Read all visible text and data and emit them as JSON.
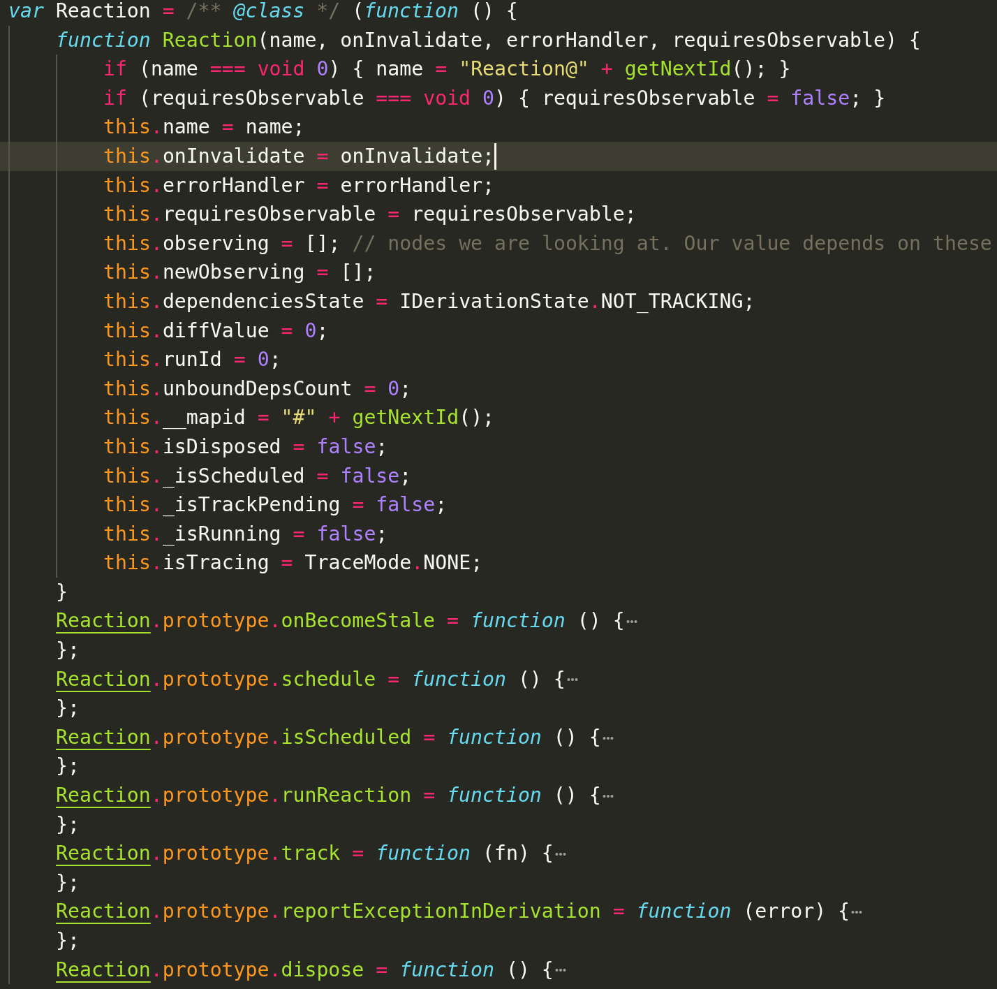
{
  "lines": [
    {
      "current": false,
      "folded": false,
      "tokens": [
        {
          "kind": "storage",
          "text": "var"
        },
        {
          "kind": "plain",
          "text": " Reaction"
        },
        {
          "kind": "keyword",
          "text": " = "
        },
        {
          "kind": "comment",
          "text": "/** "
        },
        {
          "kind": "doc-tag",
          "text": "@class"
        },
        {
          "kind": "comment",
          "text": " */"
        },
        {
          "kind": "plain",
          "text": " ("
        },
        {
          "kind": "storage",
          "text": "function"
        },
        {
          "kind": "plain",
          "text": " () {"
        }
      ],
      "children": [
        {
          "current": false,
          "folded": false,
          "tokens": [
            {
              "kind": "storage",
              "text": "function "
            },
            {
              "kind": "entity",
              "text": "Reaction"
            },
            {
              "kind": "plain",
              "text": "(name, onInvalidate, errorHandler, requiresObservable) {"
            }
          ],
          "children": [
            {
              "current": false,
              "folded": false,
              "tokens": [
                {
                  "kind": "keyword",
                  "text": "if"
                },
                {
                  "kind": "plain",
                  "text": " (name"
                },
                {
                  "kind": "keyword",
                  "text": " === void "
                },
                {
                  "kind": "number",
                  "text": "0"
                },
                {
                  "kind": "plain",
                  "text": ") { name"
                },
                {
                  "kind": "keyword",
                  "text": " = "
                },
                {
                  "kind": "string",
                  "text": "\"Reaction@\""
                },
                {
                  "kind": "keyword",
                  "text": " + "
                },
                {
                  "kind": "entity",
                  "text": "getNextId"
                },
                {
                  "kind": "plain",
                  "text": "(); }"
                }
              ]
            },
            {
              "current": false,
              "folded": false,
              "tokens": [
                {
                  "kind": "keyword",
                  "text": "if"
                },
                {
                  "kind": "plain",
                  "text": " (requiresObservable"
                },
                {
                  "kind": "keyword",
                  "text": " === void "
                },
                {
                  "kind": "number",
                  "text": "0"
                },
                {
                  "kind": "plain",
                  "text": ") { requiresObservable"
                },
                {
                  "kind": "keyword",
                  "text": " = "
                },
                {
                  "kind": "number",
                  "text": "false"
                },
                {
                  "kind": "plain",
                  "text": "; }"
                }
              ]
            },
            {
              "current": false,
              "folded": false,
              "tokens": [
                {
                  "kind": "this",
                  "text": "this"
                },
                {
                  "kind": "keyword",
                  "text": "."
                },
                {
                  "kind": "plain",
                  "text": "name"
                },
                {
                  "kind": "keyword",
                  "text": " = "
                },
                {
                  "kind": "plain",
                  "text": "name;"
                }
              ]
            },
            {
              "current": true,
              "folded": false,
              "tokens": [
                {
                  "kind": "this",
                  "text": "this"
                },
                {
                  "kind": "keyword",
                  "text": "."
                },
                {
                  "kind": "plain",
                  "text": "onInvalidate"
                },
                {
                  "kind": "keyword",
                  "text": " = "
                },
                {
                  "kind": "plain",
                  "text": "onInvalidate;"
                }
              ]
            },
            {
              "current": false,
              "folded": false,
              "tokens": [
                {
                  "kind": "this",
                  "text": "this"
                },
                {
                  "kind": "keyword",
                  "text": "."
                },
                {
                  "kind": "plain",
                  "text": "errorHandler"
                },
                {
                  "kind": "keyword",
                  "text": " = "
                },
                {
                  "kind": "plain",
                  "text": "errorHandler;"
                }
              ]
            },
            {
              "current": false,
              "folded": false,
              "tokens": [
                {
                  "kind": "this",
                  "text": "this"
                },
                {
                  "kind": "keyword",
                  "text": "."
                },
                {
                  "kind": "plain",
                  "text": "requiresObservable"
                },
                {
                  "kind": "keyword",
                  "text": " = "
                },
                {
                  "kind": "plain",
                  "text": "requiresObservable;"
                }
              ]
            },
            {
              "current": false,
              "folded": false,
              "tokens": [
                {
                  "kind": "this",
                  "text": "this"
                },
                {
                  "kind": "keyword",
                  "text": "."
                },
                {
                  "kind": "plain",
                  "text": "observing"
                },
                {
                  "kind": "keyword",
                  "text": " = "
                },
                {
                  "kind": "plain",
                  "text": "[]; "
                },
                {
                  "kind": "comment",
                  "text": "// nodes we are looking at. Our value depends on these"
                }
              ]
            },
            {
              "current": false,
              "folded": false,
              "tokens": [
                {
                  "kind": "this",
                  "text": "this"
                },
                {
                  "kind": "keyword",
                  "text": "."
                },
                {
                  "kind": "plain",
                  "text": "newObserving"
                },
                {
                  "kind": "keyword",
                  "text": " = "
                },
                {
                  "kind": "plain",
                  "text": "[];"
                }
              ]
            },
            {
              "current": false,
              "folded": false,
              "tokens": [
                {
                  "kind": "this",
                  "text": "this"
                },
                {
                  "kind": "keyword",
                  "text": "."
                },
                {
                  "kind": "plain",
                  "text": "dependenciesState"
                },
                {
                  "kind": "keyword",
                  "text": " = "
                },
                {
                  "kind": "plain",
                  "text": "IDerivationState"
                },
                {
                  "kind": "keyword",
                  "text": "."
                },
                {
                  "kind": "plain",
                  "text": "NOT_TRACKING;"
                }
              ]
            },
            {
              "current": false,
              "folded": false,
              "tokens": [
                {
                  "kind": "this",
                  "text": "this"
                },
                {
                  "kind": "keyword",
                  "text": "."
                },
                {
                  "kind": "plain",
                  "text": "diffValue"
                },
                {
                  "kind": "keyword",
                  "text": " = "
                },
                {
                  "kind": "number",
                  "text": "0"
                },
                {
                  "kind": "plain",
                  "text": ";"
                }
              ]
            },
            {
              "current": false,
              "folded": false,
              "tokens": [
                {
                  "kind": "this",
                  "text": "this"
                },
                {
                  "kind": "keyword",
                  "text": "."
                },
                {
                  "kind": "plain",
                  "text": "runId"
                },
                {
                  "kind": "keyword",
                  "text": " = "
                },
                {
                  "kind": "number",
                  "text": "0"
                },
                {
                  "kind": "plain",
                  "text": ";"
                }
              ]
            },
            {
              "current": false,
              "folded": false,
              "tokens": [
                {
                  "kind": "this",
                  "text": "this"
                },
                {
                  "kind": "keyword",
                  "text": "."
                },
                {
                  "kind": "plain",
                  "text": "unboundDepsCount"
                },
                {
                  "kind": "keyword",
                  "text": " = "
                },
                {
                  "kind": "number",
                  "text": "0"
                },
                {
                  "kind": "plain",
                  "text": ";"
                }
              ]
            },
            {
              "current": false,
              "folded": false,
              "tokens": [
                {
                  "kind": "this",
                  "text": "this"
                },
                {
                  "kind": "keyword",
                  "text": "."
                },
                {
                  "kind": "plain",
                  "text": "__mapid"
                },
                {
                  "kind": "keyword",
                  "text": " = "
                },
                {
                  "kind": "string",
                  "text": "\"#\""
                },
                {
                  "kind": "keyword",
                  "text": " + "
                },
                {
                  "kind": "entity",
                  "text": "getNextId"
                },
                {
                  "kind": "plain",
                  "text": "();"
                }
              ]
            },
            {
              "current": false,
              "folded": false,
              "tokens": [
                {
                  "kind": "this",
                  "text": "this"
                },
                {
                  "kind": "keyword",
                  "text": "."
                },
                {
                  "kind": "plain",
                  "text": "isDisposed"
                },
                {
                  "kind": "keyword",
                  "text": " = "
                },
                {
                  "kind": "number",
                  "text": "false"
                },
                {
                  "kind": "plain",
                  "text": ";"
                }
              ]
            },
            {
              "current": false,
              "folded": false,
              "tokens": [
                {
                  "kind": "this",
                  "text": "this"
                },
                {
                  "kind": "keyword",
                  "text": "."
                },
                {
                  "kind": "plain",
                  "text": "_isScheduled"
                },
                {
                  "kind": "keyword",
                  "text": " = "
                },
                {
                  "kind": "number",
                  "text": "false"
                },
                {
                  "kind": "plain",
                  "text": ";"
                }
              ]
            },
            {
              "current": false,
              "folded": false,
              "tokens": [
                {
                  "kind": "this",
                  "text": "this"
                },
                {
                  "kind": "keyword",
                  "text": "."
                },
                {
                  "kind": "plain",
                  "text": "_isTrackPending"
                },
                {
                  "kind": "keyword",
                  "text": " = "
                },
                {
                  "kind": "number",
                  "text": "false"
                },
                {
                  "kind": "plain",
                  "text": ";"
                }
              ]
            },
            {
              "current": false,
              "folded": false,
              "tokens": [
                {
                  "kind": "this",
                  "text": "this"
                },
                {
                  "kind": "keyword",
                  "text": "."
                },
                {
                  "kind": "plain",
                  "text": "_isRunning"
                },
                {
                  "kind": "keyword",
                  "text": " = "
                },
                {
                  "kind": "number",
                  "text": "false"
                },
                {
                  "kind": "plain",
                  "text": ";"
                }
              ]
            },
            {
              "current": false,
              "folded": false,
              "tokens": [
                {
                  "kind": "this",
                  "text": "this"
                },
                {
                  "kind": "keyword",
                  "text": "."
                },
                {
                  "kind": "plain",
                  "text": "isTracing"
                },
                {
                  "kind": "keyword",
                  "text": " = "
                },
                {
                  "kind": "plain",
                  "text": "TraceMode"
                },
                {
                  "kind": "keyword",
                  "text": "."
                },
                {
                  "kind": "plain",
                  "text": "NONE;"
                }
              ]
            }
          ]
        },
        {
          "current": false,
          "folded": false,
          "tokens": [
            {
              "kind": "plain",
              "text": "}"
            }
          ]
        },
        {
          "current": false,
          "folded": true,
          "tokens": [
            {
              "kind": "class-ref",
              "text": "Reaction"
            },
            {
              "kind": "keyword",
              "text": "."
            },
            {
              "kind": "this",
              "text": "prototype"
            },
            {
              "kind": "keyword",
              "text": "."
            },
            {
              "kind": "entity",
              "text": "onBecomeStale"
            },
            {
              "kind": "keyword",
              "text": " = "
            },
            {
              "kind": "storage",
              "text": "function"
            },
            {
              "kind": "plain",
              "text": " () {"
            }
          ]
        },
        {
          "current": false,
          "folded": false,
          "tokens": [
            {
              "kind": "plain",
              "text": "};"
            }
          ]
        },
        {
          "current": false,
          "folded": true,
          "tokens": [
            {
              "kind": "class-ref",
              "text": "Reaction"
            },
            {
              "kind": "keyword",
              "text": "."
            },
            {
              "kind": "this",
              "text": "prototype"
            },
            {
              "kind": "keyword",
              "text": "."
            },
            {
              "kind": "entity",
              "text": "schedule"
            },
            {
              "kind": "keyword",
              "text": " = "
            },
            {
              "kind": "storage",
              "text": "function"
            },
            {
              "kind": "plain",
              "text": " () {"
            }
          ]
        },
        {
          "current": false,
          "folded": false,
          "tokens": [
            {
              "kind": "plain",
              "text": "};"
            }
          ]
        },
        {
          "current": false,
          "folded": true,
          "tokens": [
            {
              "kind": "class-ref",
              "text": "Reaction"
            },
            {
              "kind": "keyword",
              "text": "."
            },
            {
              "kind": "this",
              "text": "prototype"
            },
            {
              "kind": "keyword",
              "text": "."
            },
            {
              "kind": "entity",
              "text": "isScheduled"
            },
            {
              "kind": "keyword",
              "text": " = "
            },
            {
              "kind": "storage",
              "text": "function"
            },
            {
              "kind": "plain",
              "text": " () {"
            }
          ]
        },
        {
          "current": false,
          "folded": false,
          "tokens": [
            {
              "kind": "plain",
              "text": "};"
            }
          ]
        },
        {
          "current": false,
          "folded": true,
          "tokens": [
            {
              "kind": "class-ref",
              "text": "Reaction"
            },
            {
              "kind": "keyword",
              "text": "."
            },
            {
              "kind": "this",
              "text": "prototype"
            },
            {
              "kind": "keyword",
              "text": "."
            },
            {
              "kind": "entity",
              "text": "runReaction"
            },
            {
              "kind": "keyword",
              "text": " = "
            },
            {
              "kind": "storage",
              "text": "function"
            },
            {
              "kind": "plain",
              "text": " () {"
            }
          ]
        },
        {
          "current": false,
          "folded": false,
          "tokens": [
            {
              "kind": "plain",
              "text": "};"
            }
          ]
        },
        {
          "current": false,
          "folded": true,
          "tokens": [
            {
              "kind": "class-ref",
              "text": "Reaction"
            },
            {
              "kind": "keyword",
              "text": "."
            },
            {
              "kind": "this",
              "text": "prototype"
            },
            {
              "kind": "keyword",
              "text": "."
            },
            {
              "kind": "entity",
              "text": "track"
            },
            {
              "kind": "keyword",
              "text": " = "
            },
            {
              "kind": "storage",
              "text": "function"
            },
            {
              "kind": "plain",
              "text": " (fn) {"
            }
          ]
        },
        {
          "current": false,
          "folded": false,
          "tokens": [
            {
              "kind": "plain",
              "text": "};"
            }
          ]
        },
        {
          "current": false,
          "folded": true,
          "tokens": [
            {
              "kind": "class-ref",
              "text": "Reaction"
            },
            {
              "kind": "keyword",
              "text": "."
            },
            {
              "kind": "this",
              "text": "prototype"
            },
            {
              "kind": "keyword",
              "text": "."
            },
            {
              "kind": "entity",
              "text": "reportExceptionInDerivation"
            },
            {
              "kind": "keyword",
              "text": " = "
            },
            {
              "kind": "storage",
              "text": "function"
            },
            {
              "kind": "plain",
              "text": " (error) {"
            }
          ]
        },
        {
          "current": false,
          "folded": false,
          "tokens": [
            {
              "kind": "plain",
              "text": "};"
            }
          ]
        },
        {
          "current": false,
          "folded": true,
          "tokens": [
            {
              "kind": "class-ref",
              "text": "Reaction"
            },
            {
              "kind": "keyword",
              "text": "."
            },
            {
              "kind": "this",
              "text": "prototype"
            },
            {
              "kind": "keyword",
              "text": "."
            },
            {
              "kind": "entity",
              "text": "dispose"
            },
            {
              "kind": "keyword",
              "text": " = "
            },
            {
              "kind": "storage",
              "text": "function"
            },
            {
              "kind": "plain",
              "text": " () {"
            }
          ]
        }
      ]
    }
  ]
}
